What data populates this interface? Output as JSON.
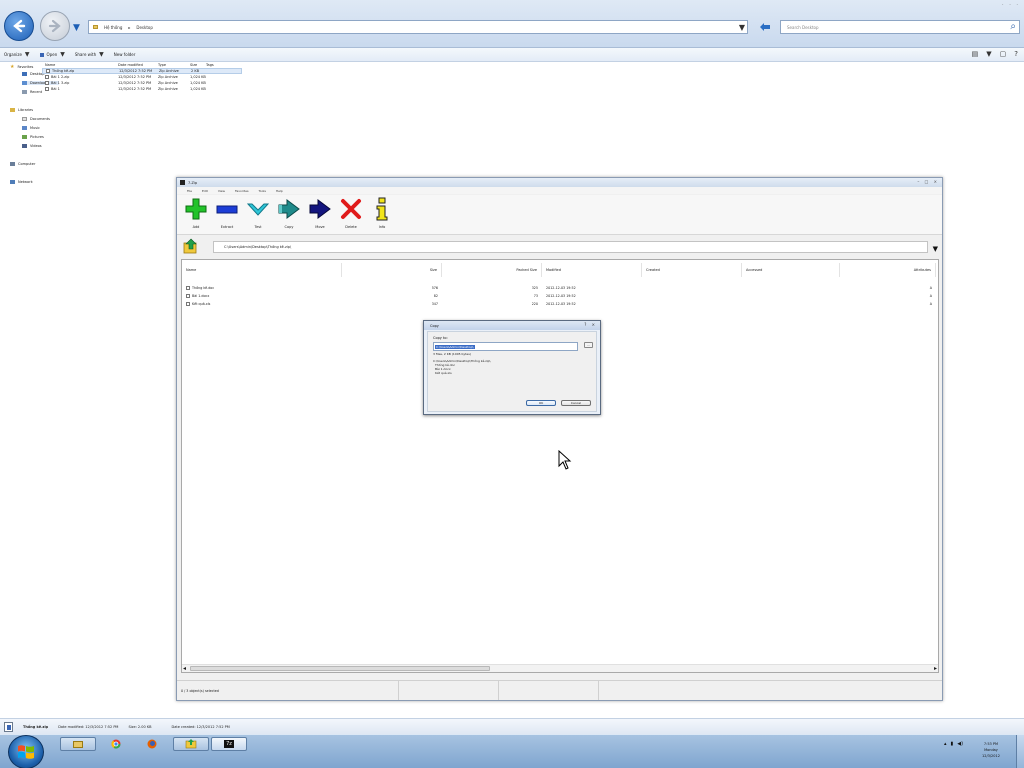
{
  "explorer": {
    "address_path": [
      "Hệ thống",
      "Desktop"
    ],
    "search_placeholder": "Search Desktop",
    "toolbar": {
      "organize": "Organize",
      "open": "Open",
      "share": "Share with",
      "new_folder": "New folder"
    },
    "nav": {
      "favorites": "Favorites",
      "fav_items": [
        "Desktop",
        "Downloads",
        "Recent"
      ],
      "libraries": "Libraries",
      "lib_items": [
        "Documents",
        "Music",
        "Pictures",
        "Videos"
      ],
      "computer": "Computer",
      "network": "Network"
    },
    "columns": [
      "Name",
      "Date modified",
      "Type",
      "Size",
      "Tags"
    ],
    "files": [
      {
        "name": "Thống kê.zip",
        "date": "12/3/2012 7:52 PM",
        "type": "Zip Archive",
        "size": "2 KB",
        "selected": true
      },
      {
        "name": "Bài 1 2.zip",
        "date": "12/3/2012 7:52 PM",
        "type": "Zip Archive",
        "size": "1,024 KB",
        "selected": false
      },
      {
        "name": "Bài 1 3.zip",
        "date": "12/3/2012 7:52 PM",
        "type": "Zip Archive",
        "size": "1,024 KB",
        "selected": false
      },
      {
        "name": "Bài 1",
        "date": "12/3/2012 7:52 PM",
        "type": "Zip Archive",
        "size": "1,024 KB",
        "selected": false
      }
    ],
    "status": {
      "name": "Thống kê.zip",
      "date_label": "Date modified: 12/3/2012 7:52 PM",
      "size_label": "Size: 2.00 KB",
      "created_label": "Date created: 12/3/2012 7:52 PM"
    }
  },
  "zip": {
    "title": "7-Zip",
    "menu": [
      "File",
      "Edit",
      "View",
      "Favorites",
      "Tools",
      "Help"
    ],
    "toolbar": [
      "Add",
      "Extract",
      "Test",
      "Copy",
      "Move",
      "Delete",
      "Info"
    ],
    "path": "C:\\Users\\Admin\\Desktop\\Thống kê.zip\\",
    "columns": [
      "Name",
      "Size",
      "Packed Size",
      "Modified",
      "Created",
      "Accessed",
      "Attributes"
    ],
    "rows": [
      {
        "name": "Thống kê.doc",
        "size": "576",
        "packed": "325",
        "modified": "2012-12-03 19:52",
        "attr": "A"
      },
      {
        "name": "Bài 1.docx",
        "size": "82",
        "packed": "73",
        "modified": "2012-12-03 19:52",
        "attr": "A"
      },
      {
        "name": "Kết quả.xls",
        "size": "347",
        "packed": "220",
        "modified": "2012-12-03 19:52",
        "attr": "A"
      }
    ],
    "status": "0 / 3 object(s) selected"
  },
  "copy_dialog": {
    "title": "Copy",
    "label": "Copy to:",
    "path_value": "C:\\Users\\Admin\\Desktop\\",
    "browse": "...",
    "info": "3 files, 2 KB (1005 bytes)",
    "files_header": "C:\\Users\\Admin\\Desktop\\Thống kê.zip\\",
    "files": [
      "Thống kê.doc",
      "Bài 1.docx",
      "Kết quả.xls"
    ],
    "ok": "OK",
    "cancel": "Cancel"
  },
  "taskbar": {
    "clock_time": "7:53 PM",
    "clock_day": "Monday",
    "clock_date": "12/3/2012"
  },
  "colors": {
    "accent": "#1d5fb6",
    "add_green": "#22c32a",
    "extract_blue": "#1c3dd6",
    "test_cyan": "#2fc6d8",
    "copy_teal": "#1f8a8a",
    "move_navy": "#13157e",
    "delete_red": "#e01b1b",
    "info_yellow": "#f2e51a"
  }
}
